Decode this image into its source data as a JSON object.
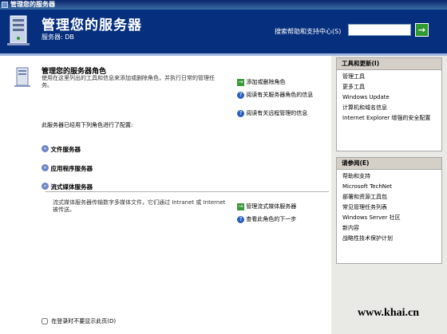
{
  "window": {
    "title": "管理您的服务器"
  },
  "header": {
    "title": "管理您的服务器",
    "server_label": "服务器: DB",
    "help_label": "搜索帮助和支持中心(S)",
    "help_value": "",
    "go_icon": "arrow-right-icon"
  },
  "main": {
    "section_title": "管理您的服务器角色",
    "section_desc": "使用在这里列出的工具和信息来添加或删除角色，并执行日常的管理任务。",
    "actions": [
      {
        "label": "添加或删除角色",
        "icon": "green-arrow-icon"
      },
      {
        "label": "阅读有关服务器角色的信息",
        "icon": "help-icon"
      },
      {
        "label": "阅读有关远程管理的信息",
        "icon": "help-icon"
      }
    ],
    "configured_text": "此服务器已经用下列角色进行了配置:",
    "roles": [
      {
        "label": "文件服务器"
      },
      {
        "label": "应用程序服务器"
      },
      {
        "label": "流式媒体服务器"
      }
    ],
    "media_desc": "流式媒体服务器传输数字多媒体文件，它们通过 Intranet 或 Internet 被传送。",
    "media_actions": [
      {
        "label": "管理流式媒体服务器",
        "icon": "green-arrow-icon"
      },
      {
        "label": "查看此角色的下一步",
        "icon": "help-icon"
      }
    ],
    "footer_checkbox_label": "在登录时不要显示此页(D)"
  },
  "tools_panel": {
    "title": "工具和更新(I)",
    "items": [
      "管理工具",
      "更多工具",
      "Windows Update",
      "计算机和域名信息",
      "Internet Explorer 增强的安全配置"
    ]
  },
  "seealso_panel": {
    "title": "请参阅(E)",
    "items": [
      "帮助和支持",
      "Microsoft TechNet",
      "部署和资源工具包",
      "常见管理任务列表",
      "Windows Server 社区",
      "新内容",
      "战略性技术保护计划"
    ]
  },
  "watermark": "www.khai.cn"
}
